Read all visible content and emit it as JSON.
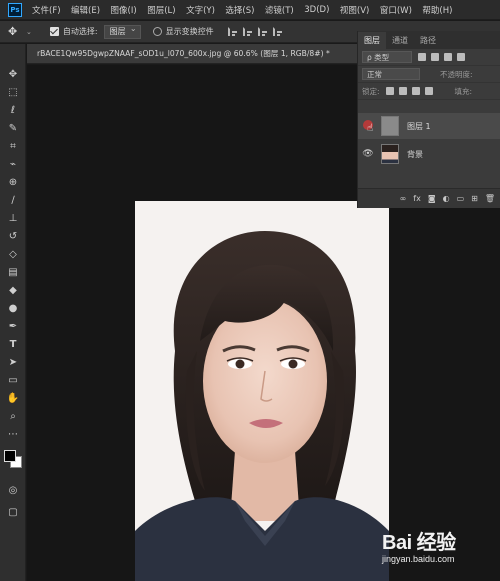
{
  "menubar": {
    "logo": "Ps",
    "items": [
      "文件(F)",
      "编辑(E)",
      "图像(I)",
      "图层(L)",
      "文字(Y)",
      "选择(S)",
      "滤镜(T)",
      "3D(D)",
      "视图(V)",
      "窗口(W)",
      "帮助(H)"
    ]
  },
  "options": {
    "auto_select_label": "自动选择:",
    "auto_select_value": "图层",
    "show_transform_label": "显示变换控件"
  },
  "document": {
    "tab_title": "rBACE1Qw95DgwpZNAAF_sOD1u_l070_600x.jpg @ 60.6% (图层 1, RGB/8#) *"
  },
  "layers_panel": {
    "tabs": [
      "图层",
      "通道",
      "路径"
    ],
    "filter_label": "ρ 类型",
    "blend_mode": "正常",
    "opacity_label": "不透明度:",
    "lock_label": "锁定:",
    "fill_label": "填充:",
    "layers": [
      {
        "name": "图层 1",
        "selected": true
      },
      {
        "name": "背景",
        "selected": false
      }
    ],
    "footer_icons": [
      "link-icon",
      "fx-icon",
      "mask-icon",
      "adjustment-icon",
      "group-icon",
      "new-layer-icon",
      "delete-icon"
    ],
    "footer_fx": "fx"
  },
  "watermark": {
    "brand": "Bai 经验",
    "url": "jingyan.baidu.com"
  },
  "colors": {
    "ps_blue": "#31a8ff",
    "panel_bg": "#3b3b3b",
    "canvas_bg": "#161616"
  }
}
